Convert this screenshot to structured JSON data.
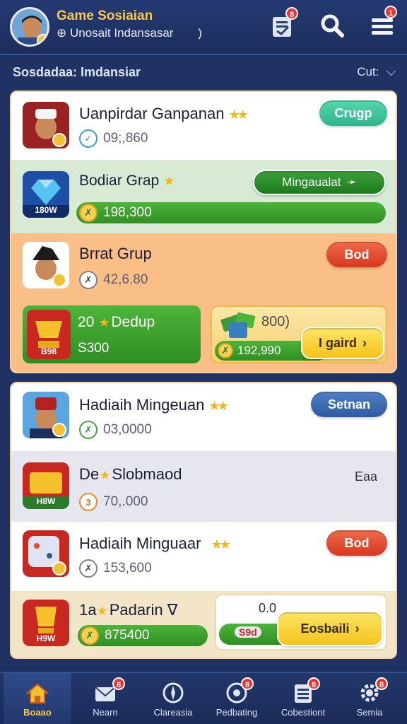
{
  "header": {
    "title": "Game Sosiaian",
    "subtitle": "Unosait Indansasar",
    "subtitle_chevron": ")",
    "notif_badge": "8",
    "menu_badge": "1"
  },
  "filter": {
    "label": "Sosdadaa:  Imdansiar",
    "sort_label": "Cut:"
  },
  "card1": {
    "row1": {
      "title": "Uanpirdar Ganpanan",
      "stat": "09;,860",
      "button": "Crugp"
    },
    "row2": {
      "thumb_label": "180W",
      "title": "Bodiar Grap",
      "button": "Mingaualat",
      "bar_value": "198,300"
    },
    "row3": {
      "title": "Brrat  Grup",
      "stat": "42,6.80",
      "button": "Bod"
    },
    "promo_left": {
      "thumb_label": "B98",
      "title": "20",
      "title2": "Dedup",
      "value": "S300"
    },
    "promo_right": {
      "label": "800)",
      "bar_value": "192,990",
      "button": "I gaird"
    }
  },
  "card2": {
    "row1": {
      "title": "Hadiaih Mingeuan",
      "stat": "03,0000",
      "button": "Setnan"
    },
    "row2": {
      "thumb_label": "H8W",
      "title_a": "De",
      "title_b": "Slobmaod",
      "right_text": "Eaa",
      "stat": "70,.000"
    },
    "row3": {
      "title": "Hadiaih Minguaar",
      "stat": "153,600",
      "button": "Bod"
    },
    "row4": {
      "thumb_label": "H9W",
      "title_a": "1a",
      "title_b": "Padarin ∇",
      "bar_value": "875400",
      "panel_label": "0.0",
      "panel_badge": "S9d",
      "button": "Eosbaili"
    }
  },
  "nav": [
    {
      "label": "Boaao",
      "icon": "home-icon"
    },
    {
      "label": "Nearn",
      "icon": "mail-icon"
    },
    {
      "label": "Clareasia",
      "icon": "compass-icon"
    },
    {
      "label": "Pedbating",
      "icon": "target-icon"
    },
    {
      "label": "Cobestiont",
      "icon": "list-icon"
    },
    {
      "label": "Semia",
      "icon": "gear-icon"
    }
  ],
  "nav_badges": [
    "8",
    "8",
    "8",
    "8"
  ],
  "colors": {
    "bg": "#1f3263",
    "row_green_bg": "#d8ead3",
    "row_orange_bg": "#f9bf86",
    "teal_button": "#39c29a",
    "green_button": "#2f8f23",
    "red_button": "#e24a32",
    "blue_button": "#2f5aa1",
    "yellow_button": "#f7cf26"
  }
}
